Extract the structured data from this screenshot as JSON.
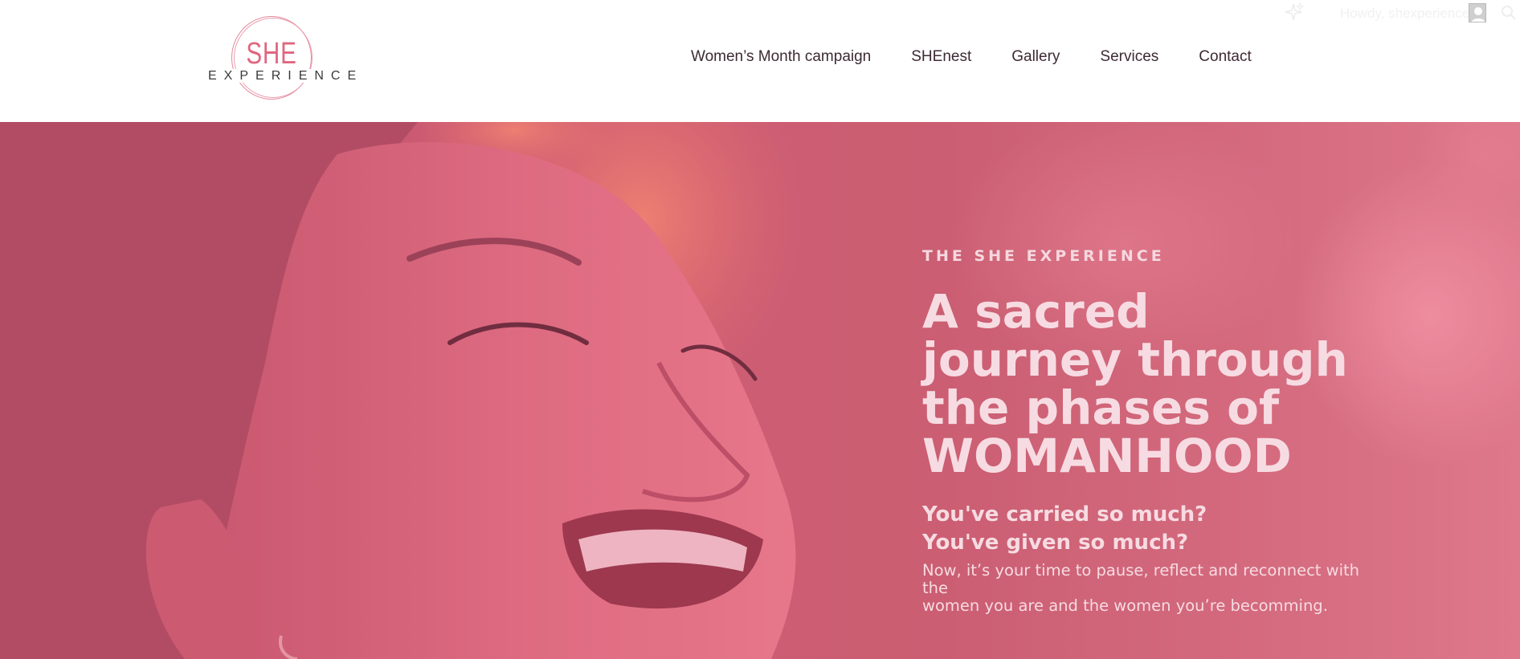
{
  "admin_bar": {
    "greeting": "Howdy, shexperience",
    "icons": [
      "sparkle-icon",
      "avatar-icon",
      "search-icon"
    ]
  },
  "logo": {
    "main": "SHE",
    "sub": "EXPERIENCE"
  },
  "nav": {
    "items": [
      {
        "label": "Women’s Month campaign"
      },
      {
        "label": "SHEnest"
      },
      {
        "label": "Gallery"
      },
      {
        "label": "Services"
      },
      {
        "label": "Contact"
      }
    ]
  },
  "hero": {
    "eyebrow": "THE SHE EXPERIENCE",
    "headline_lines": [
      "A sacred",
      "journey through",
      "the phases of",
      "WOMANHOOD"
    ],
    "sub_lines": [
      "You've carried so much?",
      "You've given so much?"
    ],
    "body_lines": [
      "Now, it’s your time to pause, reflect and reconnect with the",
      "women you are and the women you’re becomming."
    ]
  },
  "colors": {
    "hero_overlay": "#c95a70",
    "hero_text": "#f7dbe2",
    "logo_pink": "#e0667f",
    "nav_text": "#3d2a34"
  }
}
